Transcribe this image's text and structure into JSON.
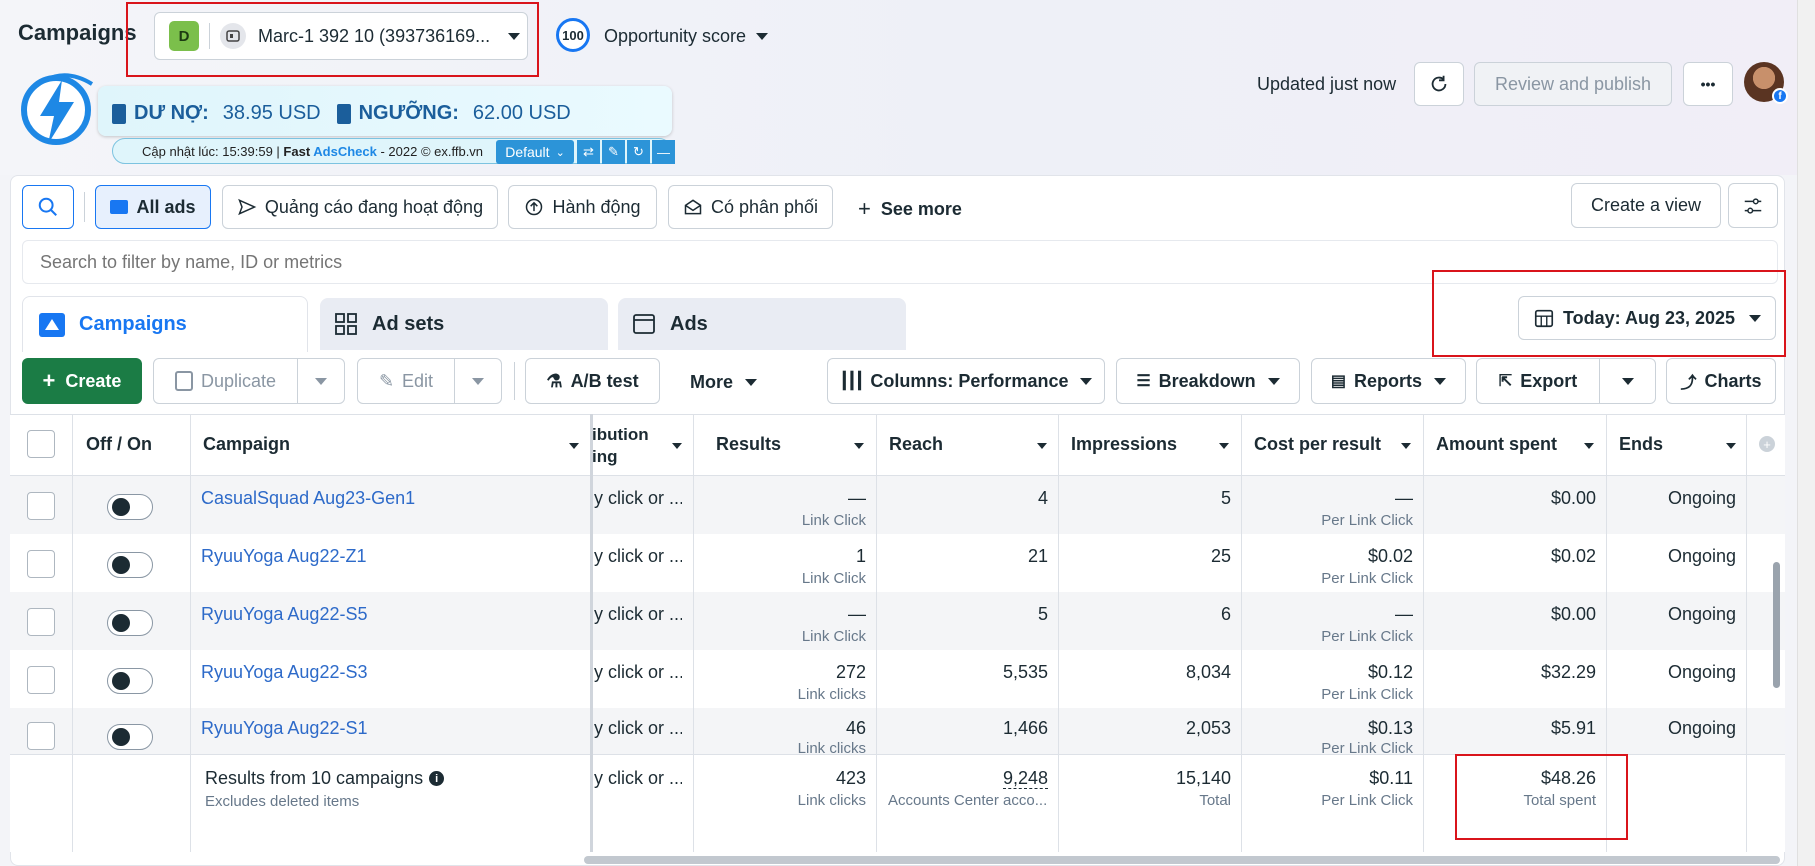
{
  "header": {
    "title": "Campaigns",
    "account_badge": "D",
    "account_name": "Marc-1 392 10 (393736169...",
    "opportunity_score_value": "100",
    "opportunity_score_label": "Opportunity score",
    "updated_text": "Updated just now",
    "review_publish_label": "Review and publish",
    "more_label": "•••"
  },
  "extension": {
    "debt_label": "DƯ NỢ:",
    "debt_value": "38.95 USD",
    "threshold_label": "NGƯỠNG:",
    "threshold_value": "62.00 USD",
    "footer_prefix": "Cập nhật lúc: 15:39:59 | ",
    "footer_brand1": "Fast ",
    "footer_brand2": "AdsCheck",
    "footer_suffix": " - 2022 © ex.ffb.vn",
    "default_label": "Default"
  },
  "filters": {
    "all_ads": "All ads",
    "active_ads": "Quảng cáo đang hoạt động",
    "actions": "Hành động",
    "delivery": "Có phân phối",
    "see_more": "See more",
    "create_view": "Create a view",
    "search_placeholder": "Search to filter by name, ID or metrics"
  },
  "tabs": {
    "campaigns": "Campaigns",
    "ad_sets": "Ad sets",
    "ads": "Ads",
    "date": "Today: Aug 23, 2025"
  },
  "toolbar": {
    "create": "Create",
    "duplicate": "Duplicate",
    "edit": "Edit",
    "ab_test": "A/B test",
    "more": "More",
    "columns": "Columns: Performance",
    "breakdown": "Breakdown",
    "reports": "Reports",
    "export": "Export",
    "charts": "Charts"
  },
  "table": {
    "headers": {
      "off_on": "Off / On",
      "campaign": "Campaign",
      "attribution_1": "ibution",
      "attribution_2": "ing",
      "results": "Results",
      "reach": "Reach",
      "impressions": "Impressions",
      "cost_per_result": "Cost per result",
      "amount_spent": "Amount spent",
      "ends": "Ends"
    },
    "rows": [
      {
        "name": "CasualSquad Aug23-Gen1",
        "attribution": "y click or ...",
        "results": "—",
        "results_sub": "Link Click",
        "reach": "4",
        "impressions": "5",
        "cpr": "—",
        "cpr_sub": "Per Link Click",
        "spent": "$0.00",
        "ends": "Ongoing"
      },
      {
        "name": "RyuuYoga Aug22-Z1",
        "attribution": "y click or ...",
        "results": "1",
        "results_sub": "Link Click",
        "reach": "21",
        "impressions": "25",
        "cpr": "$0.02",
        "cpr_sub": "Per Link Click",
        "spent": "$0.02",
        "ends": "Ongoing"
      },
      {
        "name": "RyuuYoga Aug22-S5",
        "attribution": "y click or ...",
        "results": "—",
        "results_sub": "Link Click",
        "reach": "5",
        "impressions": "6",
        "cpr": "—",
        "cpr_sub": "Per Link Click",
        "spent": "$0.00",
        "ends": "Ongoing"
      },
      {
        "name": "RyuuYoga Aug22-S3",
        "attribution": "y click or ...",
        "results": "272",
        "results_sub": "Link clicks",
        "reach": "5,535",
        "impressions": "8,034",
        "cpr": "$0.12",
        "cpr_sub": "Per Link Click",
        "spent": "$32.29",
        "ends": "Ongoing"
      },
      {
        "name": "RyuuYoga Aug22-S1",
        "attribution": "y click or ...",
        "results": "46",
        "results_sub": "Link clicks",
        "reach": "1,466",
        "impressions": "2,053",
        "cpr": "$0.13",
        "cpr_sub": "Per Link Click",
        "spent": "$5.91",
        "ends": "Ongoing"
      }
    ],
    "summary": {
      "title": "Results from 10 campaigns",
      "subtitle": "Excludes deleted items",
      "attribution": "y click or ...",
      "results": "423",
      "results_sub": "Link clicks",
      "reach": "9,248",
      "reach_sub": "Accounts Center acco...",
      "impressions": "15,140",
      "impressions_sub": "Total",
      "cpr": "$0.11",
      "cpr_sub": "Per Link Click",
      "spent": "$48.26",
      "spent_sub": "Total spent"
    }
  },
  "colors": {
    "accent": "#1877f2",
    "create_green": "#1b7c45",
    "link_blue": "#2d6ac9",
    "highlight_red": "#d9141b"
  }
}
